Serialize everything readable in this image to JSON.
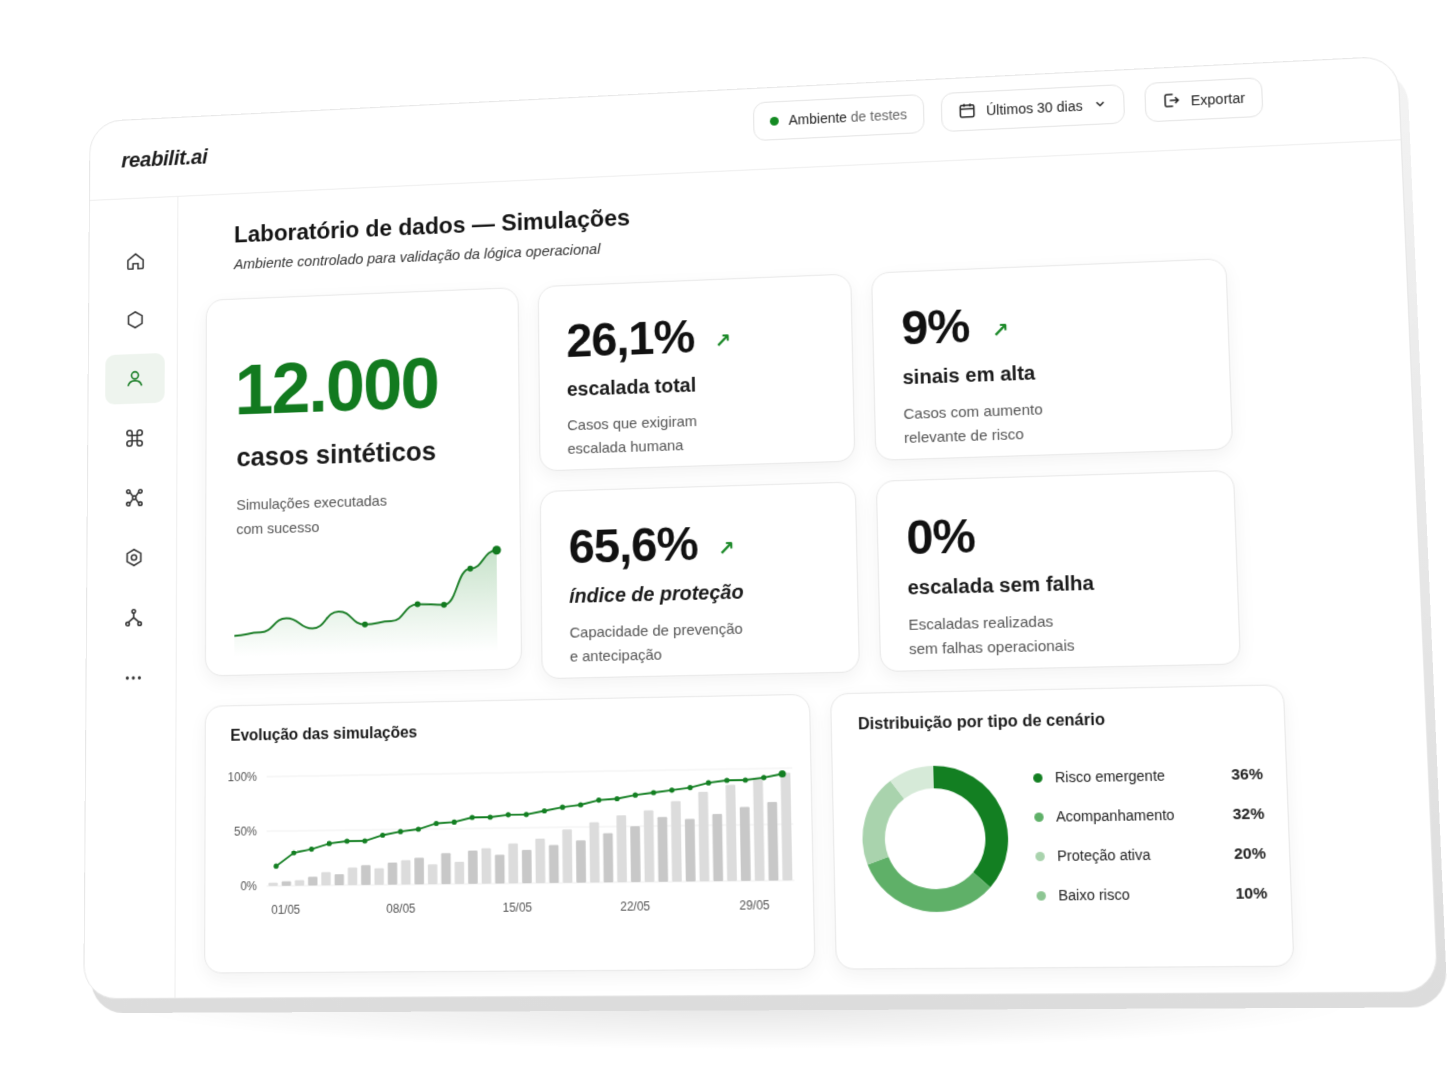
{
  "app": {
    "brand": "reabilit.ai"
  },
  "header": {
    "environment": {
      "strong": "Ambiente",
      "rest": "de testes"
    },
    "range": {
      "label": "Últimos 30 dias"
    },
    "export": {
      "label": "Exportar"
    }
  },
  "sidebar": {
    "items": [
      {
        "icon": "home-icon"
      },
      {
        "icon": "hexagon-icon"
      },
      {
        "icon": "user-icon",
        "active": true
      },
      {
        "icon": "command-icon"
      },
      {
        "icon": "network-icon"
      },
      {
        "icon": "shield-icon"
      },
      {
        "icon": "branch-icon"
      },
      {
        "icon": "more-icon"
      }
    ]
  },
  "page": {
    "title": "Laboratório de dados — Simulações",
    "subtitle": "Ambiente controlado para validação da lógica operacional"
  },
  "kpis": {
    "main": {
      "value": "12.000",
      "label": "casos sintéticos",
      "desc_line1": "Simulações executadas",
      "desc_line2": "com sucesso"
    },
    "escalated": {
      "value": "26,1%",
      "arrow": "↗",
      "label": "escalada total",
      "desc_line1": "Casos que exigiram",
      "desc_line2": "escalada humana"
    },
    "high_signals": {
      "value": "9%",
      "arrow": "↗",
      "label": "sinais em alta",
      "desc_line1": "Casos com aumento",
      "desc_line2": "relevante de risco"
    },
    "protection": {
      "value": "65,6%",
      "arrow": "↗",
      "label": "índice de proteção",
      "desc_line1": "Capacidade de prevenção",
      "desc_line2": "e antecipação"
    },
    "no_fail": {
      "value": "0%",
      "label": "escalada sem falha",
      "desc_line1": "Escaladas realizadas",
      "desc_line2": "sem falhas operacionais"
    }
  },
  "colors": {
    "accent": "#127a1f",
    "accent_light": "#7cc283",
    "accent_pale": "#c9e2cb"
  },
  "chart_data": [
    {
      "type": "line",
      "series": [
        {
          "values": [
            10,
            12,
            22,
            14,
            26,
            16,
            18,
            30,
            29,
            55,
            68
          ]
        }
      ],
      "x": [
        1,
        2,
        3,
        4,
        5,
        6,
        7,
        8,
        9,
        10,
        11
      ]
    },
    {
      "type": "bar",
      "title": "Evolução das simulações",
      "x_ticks": [
        "01/05",
        "08/05",
        "15/05",
        "22/05",
        "29/05"
      ],
      "y_ticks": [
        "100%",
        "50%",
        "0%"
      ],
      "ylim": [
        0,
        100
      ],
      "line_series": {
        "values": [
          18,
          30,
          33,
          38,
          40,
          40,
          45,
          48,
          50,
          55,
          56,
          60,
          60,
          62,
          62,
          65,
          68,
          70,
          74,
          75,
          78,
          80,
          82,
          84,
          88,
          90,
          90,
          92,
          95
        ]
      },
      "bar_series": {
        "values": [
          3,
          4,
          5,
          8,
          12,
          10,
          16,
          18,
          15,
          20,
          22,
          24,
          18,
          28,
          20,
          30,
          32,
          26,
          36,
          30,
          40,
          34,
          48,
          38,
          54,
          44,
          60,
          50,
          64,
          58,
          72,
          56,
          80,
          60,
          86,
          66,
          92,
          70,
          96
        ]
      }
    },
    {
      "type": "pie",
      "title": "Distribuição por tipo de cenário",
      "categories": [
        "Risco emergente",
        "Acompanhamento",
        "Proteção ativa",
        "Baixo risco"
      ],
      "values": [
        36,
        32,
        20,
        10
      ],
      "labels": [
        "36%",
        "32%",
        "20%",
        "10%"
      ],
      "colors": [
        "#137f22",
        "#5fb068",
        "#a9d3ad",
        "#d6ead8"
      ]
    }
  ]
}
